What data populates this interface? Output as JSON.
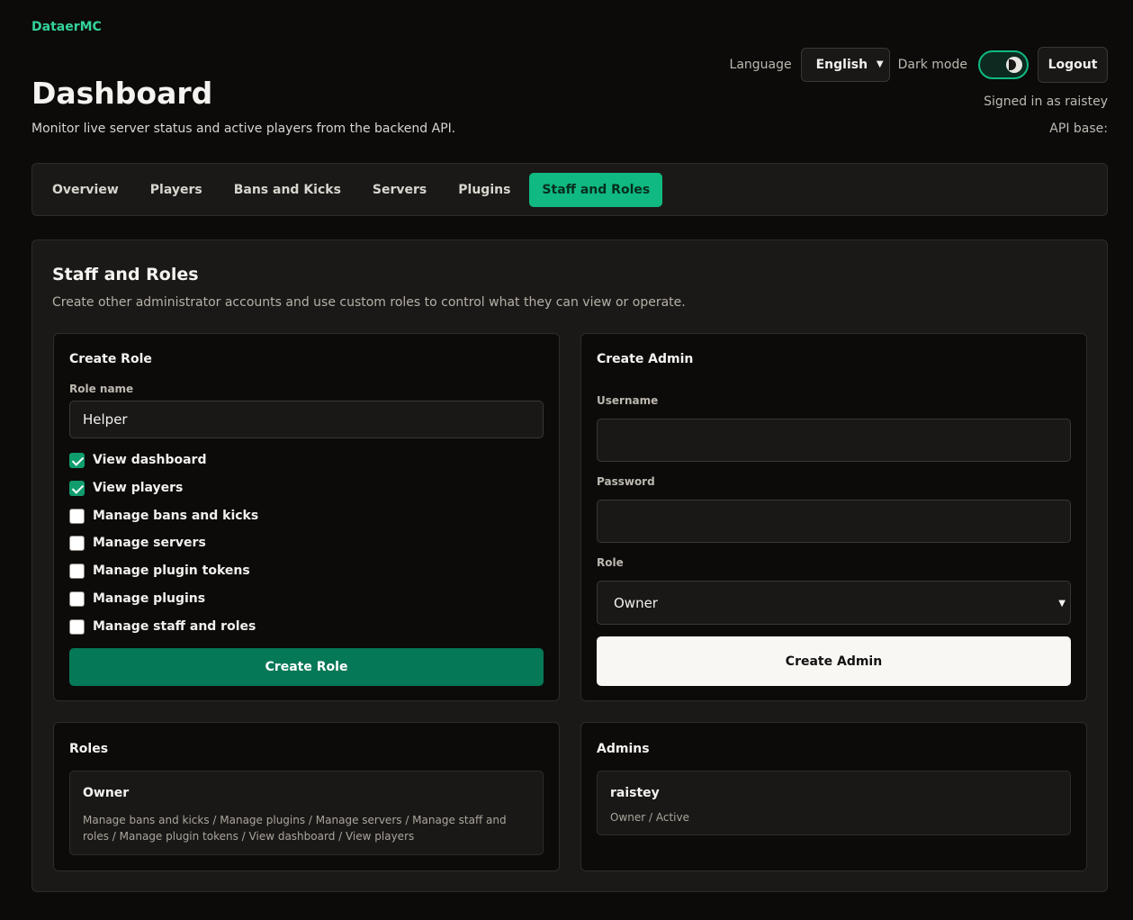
{
  "brand": "DataerMC",
  "page": {
    "title": "Dashboard",
    "subtitle": "Monitor live server status and active players from the backend API."
  },
  "top_controls": {
    "language_label": "Language",
    "language_value": "English",
    "dark_mode_label": "Dark mode",
    "dark_mode_on": true,
    "logout_label": "Logout",
    "signed_in_text": "Signed in as raistey",
    "api_base_text": "API base:"
  },
  "tabs": [
    {
      "label": "Overview",
      "active": false
    },
    {
      "label": "Players",
      "active": false
    },
    {
      "label": "Bans and Kicks",
      "active": false
    },
    {
      "label": "Servers",
      "active": false
    },
    {
      "label": "Plugins",
      "active": false
    },
    {
      "label": "Staff and Roles",
      "active": true
    }
  ],
  "section": {
    "title": "Staff and Roles",
    "description": "Create other administrator accounts and use custom roles to control what they can view or operate."
  },
  "create_role": {
    "title": "Create Role",
    "role_name_label": "Role name",
    "role_name_value": "Helper",
    "permissions": [
      {
        "label": "View dashboard",
        "checked": true
      },
      {
        "label": "View players",
        "checked": true
      },
      {
        "label": "Manage bans and kicks",
        "checked": false
      },
      {
        "label": "Manage servers",
        "checked": false
      },
      {
        "label": "Manage plugin tokens",
        "checked": false
      },
      {
        "label": "Manage plugins",
        "checked": false
      },
      {
        "label": "Manage staff and roles",
        "checked": false
      }
    ],
    "submit_label": "Create Role"
  },
  "create_admin": {
    "title": "Create Admin",
    "username_label": "Username",
    "username_value": "",
    "password_label": "Password",
    "password_value": "",
    "role_label": "Role",
    "role_value": "Owner",
    "submit_label": "Create Admin"
  },
  "roles": {
    "title": "Roles",
    "items": [
      {
        "name": "Owner",
        "permissions_text": "Manage bans and kicks / Manage plugins / Manage servers / Manage staff and roles / Manage plugin tokens / View dashboard / View players"
      }
    ]
  },
  "admins": {
    "title": "Admins",
    "items": [
      {
        "name": "raistey",
        "meta": "Owner / Active"
      }
    ]
  },
  "colors": {
    "accent": "#10b981",
    "accent_dark": "#047857",
    "background": "#0c0b0a",
    "surface": "#1b1917"
  }
}
